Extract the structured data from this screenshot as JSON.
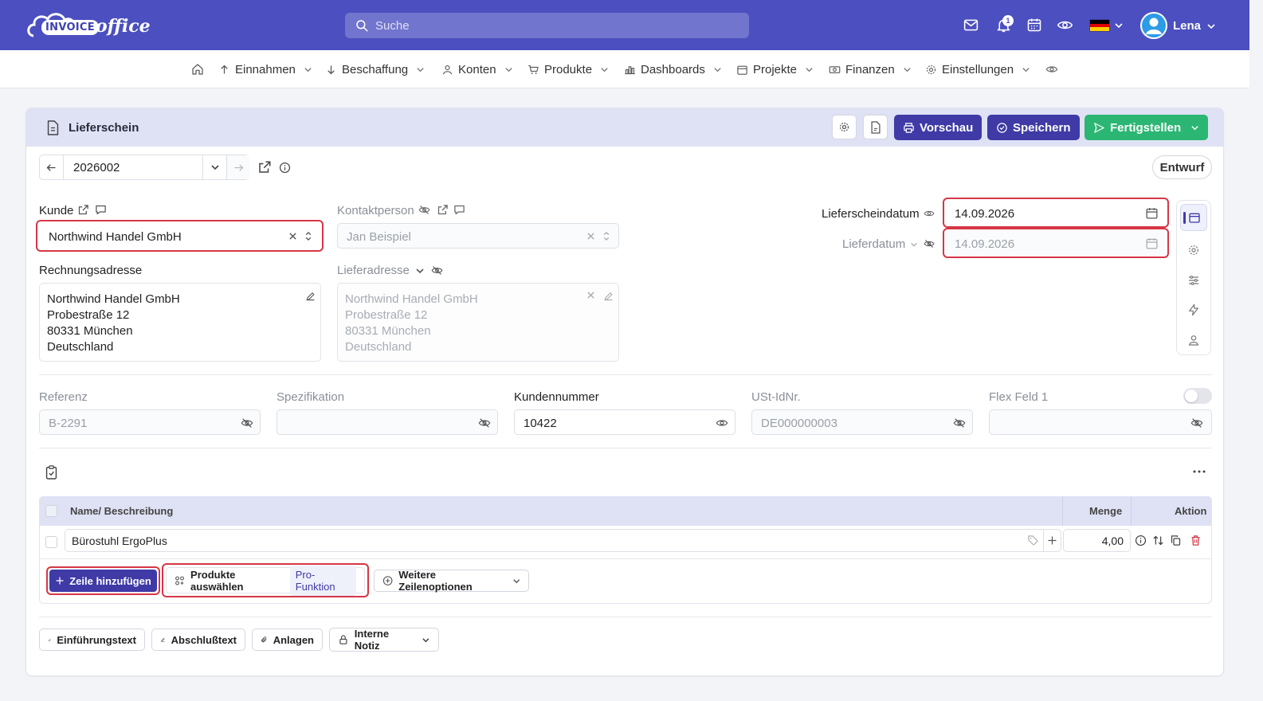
{
  "header": {
    "logo_invoice": "INVOICE",
    "logo_office": "office",
    "search_placeholder": "Suche",
    "notification_count": "1",
    "user_name": "Lena"
  },
  "nav": {
    "items": [
      {
        "label": "Einnahmen"
      },
      {
        "label": "Beschaffung"
      },
      {
        "label": "Konten"
      },
      {
        "label": "Produkte"
      },
      {
        "label": "Dashboards"
      },
      {
        "label": "Projekte"
      },
      {
        "label": "Finanzen"
      },
      {
        "label": "Einstellungen"
      }
    ]
  },
  "doc": {
    "title": "Lieferschein",
    "preview_label": "Vorschau",
    "save_label": "Speichern",
    "finish_label": "Fertigstellen",
    "number": "2026002",
    "status": "Entwurf"
  },
  "customer": {
    "kunde_label": "Kunde",
    "kunde_value": "Northwind Handel GmbH",
    "kontakt_label": "Kontaktperson",
    "kontakt_value": "Jan Beispiel",
    "rechnung_label": "Rechnungsadresse",
    "rechnung_lines": [
      "Northwind Handel GmbH",
      "Probestraße 12",
      "80331 München",
      "Deutschland"
    ],
    "liefer_label": "Lieferadresse",
    "liefer_lines": [
      "Northwind Handel GmbH",
      "Probestraße 12",
      "80331 München",
      "Deutschland"
    ]
  },
  "dates": {
    "lieferscheindatum_label": "Lieferscheindatum",
    "lieferscheindatum_value": "14.09.2026",
    "lieferdatum_label": "Lieferdatum",
    "lieferdatum_value": "14.09.2026"
  },
  "extra_fields": [
    {
      "label": "Referenz",
      "value": "B-2291"
    },
    {
      "label": "Spezifikation",
      "value": ""
    },
    {
      "label": "Kundennummer",
      "value": "10422"
    },
    {
      "label": "USt-IdNr.",
      "value": "DE000000003"
    },
    {
      "label": "Flex Feld 1",
      "value": ""
    }
  ],
  "table": {
    "col_name": "Name/ Beschreibung",
    "col_qty": "Menge",
    "col_action": "Aktion",
    "rows": [
      {
        "name": "Bürostuhl ErgoPlus",
        "qty": "4,00"
      }
    ]
  },
  "row_actions": {
    "add_row": "Zeile hinzufügen",
    "select_products": "Produkte auswählen",
    "pro_badge": "Pro-Funktion",
    "more_options": "Weitere Zeilenoptionen"
  },
  "footer_buttons": {
    "intro": "Einführungstext",
    "closing": "Abschlußtext",
    "attachments": "Anlagen",
    "internal_note": "Interne Notiz"
  },
  "colors": {
    "brand": "#4b4fbf",
    "primary_button": "#3f3aa6",
    "success_button": "#2bb673",
    "highlight_border": "#d63646"
  }
}
